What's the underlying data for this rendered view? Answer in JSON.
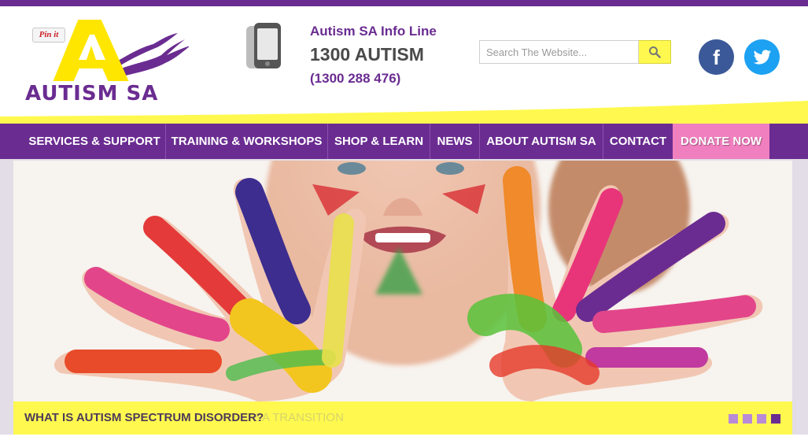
{
  "header": {
    "pinit_label": "Pin it",
    "logo_text": "AUTISM SA",
    "info_line_title": "Autism SA Info Line",
    "info_line_number": "1300 AUTISM",
    "info_line_digits": "(1300 288 476)",
    "search_placeholder": "Search The Website...",
    "search_icon": "magnifier-icon",
    "social": [
      "facebook-icon",
      "twitter-icon"
    ],
    "facebook_glyph": "f"
  },
  "nav": {
    "items": [
      {
        "label": "SERVICES & SUPPORT"
      },
      {
        "label": "TRAINING & WORKSHOPS"
      },
      {
        "label": "SHOP & LEARN"
      },
      {
        "label": "NEWS"
      },
      {
        "label": "ABOUT AUTISM SA"
      },
      {
        "label": "CONTACT"
      },
      {
        "label": "DONATE NOW"
      }
    ]
  },
  "hero": {
    "image": "child with paint-covered hands",
    "caption": "WHAT IS AUTISM SPECTRUM DISORDER?",
    "caption_ghost": "SA TRANSITION",
    "slides_total": 4,
    "active_slide": 4
  },
  "colors": {
    "brand_purple": "#6a2c91",
    "brand_yellow": "#fff94f",
    "donate_pink": "#f07fbf",
    "facebook_blue": "#3b5998",
    "twitter_blue": "#1da1f2"
  }
}
